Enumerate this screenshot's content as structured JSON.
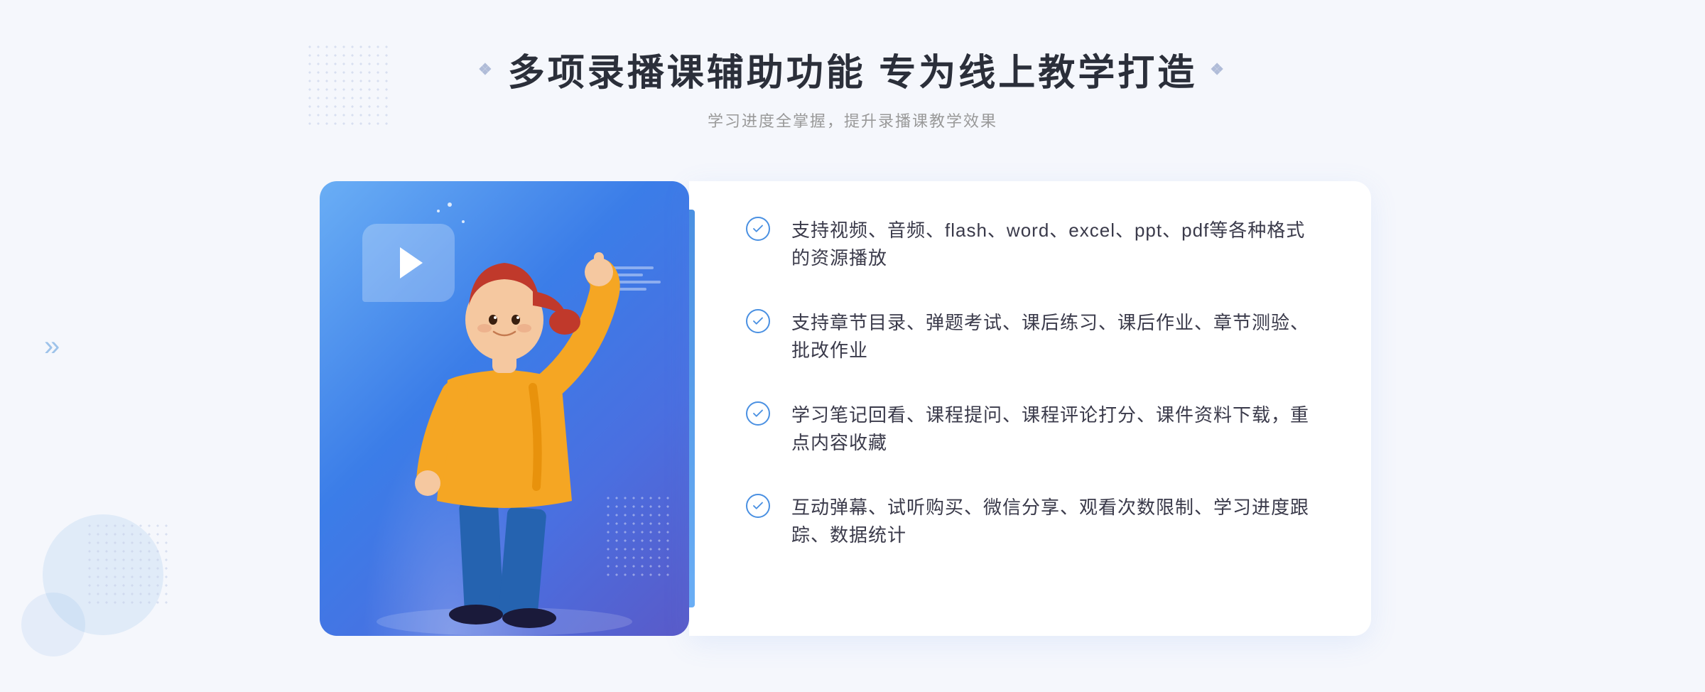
{
  "header": {
    "dots_label": "❖",
    "title": "多项录播课辅助功能 专为线上教学打造",
    "subtitle": "学习进度全掌握，提升录播课教学效果"
  },
  "features": [
    {
      "id": "feature-1",
      "text": "支持视频、音频、flash、word、excel、ppt、pdf等各种格式的资源播放"
    },
    {
      "id": "feature-2",
      "text": "支持章节目录、弹题考试、课后练习、课后作业、章节测验、批改作业"
    },
    {
      "id": "feature-3",
      "text": "学习笔记回看、课程提问、课程评论打分、课件资料下载，重点内容收藏"
    },
    {
      "id": "feature-4",
      "text": "互动弹幕、试听购买、微信分享、观看次数限制、学习进度跟踪、数据统计"
    }
  ],
  "decorative": {
    "chevron_left": "»",
    "dots": "⁞⁞"
  }
}
